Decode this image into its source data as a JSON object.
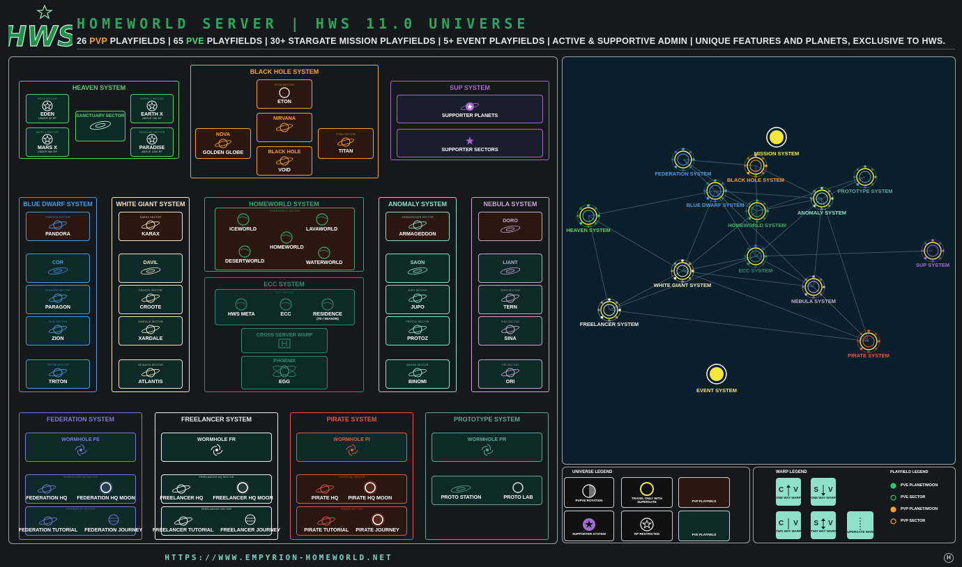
{
  "logo_text": "HWS",
  "title": "HOMEWORLD SERVER | HWS 11.0 UNIVERSE",
  "subtitle": {
    "a": "26 ",
    "b": "PVP",
    "c": " PLAYFIELDS | 65 ",
    "d": "PVE",
    "e": " PLAYFIELDS | 30+ STARGATE MISSION PLAYFIELDS | 5+ EVENT PLAYFIELDS | ACTIVE & SUPPORTIVE ADMIN | UNIQUE FEATURES AND PLANETS, EXCLUSIVE TO HWS."
  },
  "colors": {
    "pve": "#2bc46a",
    "pvp": "#f7a12c",
    "bg": "#15191c",
    "pvpbox": "#2b170f",
    "pvebox": "#0e2a28",
    "heaven": "#5bd06a",
    "blackhole": "#f5a332",
    "sup": "#a36bd0",
    "bluedwarf": "#4a9be0",
    "whitegiant": "#f2e6c4",
    "homeworld": "#3ba86e",
    "ecc": "#2e8a72",
    "anomaly": "#8ee0c8",
    "nebula": "#c9a6d2",
    "federation": "#7b7ad8",
    "freelancer": "#e8f0f0",
    "pirate": "#e55a42",
    "prototype": "#5da89a"
  },
  "systems": {
    "heaven": {
      "title": "HEAVEN SYSTEM",
      "eden": {
        "sec": "EDEN SECTOR",
        "name": "EDEN",
        "note": "UNDER 50 RP"
      },
      "earthx": {
        "sec": "EARTH X SECTOR",
        "name": "EARTH X",
        "note": "ABOVE 100 RP"
      },
      "sanctuary": "SANCTUARY SECTOR",
      "marsx": {
        "sec": "MARS X SECTOR",
        "name": "MARS X",
        "note": "UNDER 500 RP"
      },
      "paradise": {
        "sec": "PARADISE SECTOR",
        "name": "PARADISE",
        "note": "ABOVE 1000 RP"
      }
    },
    "blackhole": {
      "title": "BLACK HOLE SYSTEM",
      "eton": {
        "sec": "ETON SECTOR",
        "name": "ETON"
      },
      "nirvana": "NIRVANA",
      "nova": "NOVA",
      "golden": "GOLDEN GLOBE",
      "titan": {
        "sec": "TITAN SECTOR",
        "name": "TITAN"
      },
      "blackhole": "BLACK HOLE",
      "void": "VOID"
    },
    "sup": {
      "title": "SUP SYSTEM",
      "planets": "SUPPORTER PLANETS",
      "sectors": "SUPPORTER SECTORS"
    },
    "bluedwarf": {
      "title": "BLUE DWARF SYSTEM",
      "items": [
        {
          "sec": "PANDORA SECTOR",
          "name": "PANDORA"
        },
        {
          "sec": "",
          "name": "COR"
        },
        {
          "sec": "PARAGON SECTOR",
          "name": "PARAGON"
        },
        {
          "sec": "ZION SECTOR",
          "name": "ZION"
        },
        {
          "sec": "TRITON SECTOR",
          "name": "TRITON"
        }
      ]
    },
    "whitegiant": {
      "title": "WHITE GIANT SYSTEM",
      "items": [
        {
          "sec": "KARAX SECTOR",
          "name": "KARAX"
        },
        {
          "sec": "",
          "name": "DAVIL"
        },
        {
          "sec": "CROOTE SECTOR",
          "name": "CROOTE"
        },
        {
          "sec": "XARDALE SECTOR",
          "name": "XARDALE"
        },
        {
          "sec": "ATLANTIS SECTOR",
          "name": "ATLANTIS"
        }
      ]
    },
    "homeworld": {
      "title": "HOMEWORLD SYSTEM",
      "sec": "HOMEWORLD SECTOR",
      "iceworld": "ICEWORLD",
      "lavaworld": "LAVAWORLD",
      "homeworld": "HOMEWORLD",
      "desertworld": "DESERTWORLD",
      "waterworld": "WATERWORLD"
    },
    "ecc": {
      "title": "ECC SYSTEM",
      "sec": "ECC SECTOR",
      "hwsmeta": "HWS META",
      "ecc": "ECC",
      "residence": "RESIDENCE",
      "residence_note": "(7D / Season)",
      "warp": "CROSS SERVER WARP",
      "phoenix": "PHOENIX",
      "egg": "EGG"
    },
    "anomaly": {
      "title": "ANOMALY SYSTEM",
      "items": [
        {
          "sec": "ARMAGEDDON SECTOR",
          "name": "ARMAGEDDON"
        },
        {
          "sec": "",
          "name": "SAON"
        },
        {
          "sec": "JUPO SECTOR",
          "name": "JUPO"
        },
        {
          "sec": "PROTOZ SECTOR",
          "name": "PROTOZ"
        },
        {
          "sec": "BINOMI SECTOR",
          "name": "BINOMI"
        }
      ]
    },
    "nebula": {
      "title": "NEBULA SYSTEM",
      "items": [
        {
          "sec": "",
          "name": "DORO"
        },
        {
          "sec": "",
          "name": "LIANT"
        },
        {
          "sec": "TERN SECTOR",
          "name": "TERN"
        },
        {
          "sec": "SINA SECTOR",
          "name": "SINA"
        },
        {
          "sec": "ORI SECTOR",
          "name": "ORI"
        }
      ]
    },
    "federation": {
      "title": "FEDERATION SYSTEM",
      "wormhole": "WORMHOLE FE",
      "hqsec": "FEDERATION HQ SECTOR",
      "hq": "FEDERATION HQ",
      "moon": "FEDERATION HQ MOON",
      "tsec": "FEDERATION SECTOR",
      "tut": "FEDERATION TUTORIAL",
      "journey": "FEDERATION JOURNEY"
    },
    "freelancer": {
      "title": "FREELANCER SYSTEM",
      "wormhole": "WORMHOLE FR",
      "hqsec": "FREELANCER HQ SECTOR",
      "hq": "FREELANCER HQ",
      "moon": "FREELANCER HQ MOON",
      "tsec": "FREELANCER SECTOR",
      "tut": "FREELANCER TUTORIAL",
      "journey": "FREELANCER JOURNEY"
    },
    "pirate": {
      "title": "PIRATE SYSTEM",
      "wormhole": "WORMHOLE PI",
      "hqsec": "PIRATE HQ SECTOR",
      "hq": "PIRATE HQ",
      "moon": "PIRATE HQ MOON",
      "tsec": "PIRATE SECTOR",
      "tut": "PIRATE TUTORIAL",
      "journey": "PIRATE JOURNEY"
    },
    "prototype": {
      "title": "PROTOTYPE SYSTEM",
      "wormhole": "WORMHOLE PR",
      "station": "PROTO STATION",
      "lab": "PROTO LAB"
    }
  },
  "map_labels": {
    "mission": "MISSION SYSTEM",
    "federation": "FEDERATION SYSTEM",
    "blackhole": "BLACK HOLE SYSTEM",
    "prototype": "PROTOTYPE SYSTEM",
    "bluedwarf": "BLUE DWARF SYSTEM",
    "anomaly": "ANOMALY SYSTEM",
    "homeworld": "HOMEWORLD SYSTEM",
    "heaven": "HEAVEN SYSTEM",
    "ecc": "ECC SYSTEM",
    "sup": "SUP SYSTEM",
    "whitegiant": "WHITE GIANT SYSTEM",
    "nebula": "NEBULA SYSTEM",
    "freelancer": "FREELANCER SYSTEM",
    "pirate": "PIRATE SYSTEM",
    "event": "EVENT SYSTEM"
  },
  "universe_legend": {
    "title": "UNIVERSE LEGEND",
    "pvpve": "PvPvE ROTATION",
    "superwarp": "TRAVEL ONLY WITH SUPERGATE",
    "pvpfield": "PVP PLAYFIELD",
    "supporter": "SUPPORTER SYSTEM",
    "rp": "RP RESTRICTED",
    "pvefield": "PVE PLAYFIELD"
  },
  "warp_legend": {
    "title": "WARP LEGEND",
    "c": "C",
    "v": "V",
    "s": "S",
    "oneway1": "ONE WAY WARP",
    "oneway2": "ONE WAY WARP",
    "twoway1": "TWO WAY WARP",
    "twoway2": "TWO WAY WARP",
    "supergate": "SUPERGATE WARP"
  },
  "playfield_legend": {
    "title": "PLAYFIELD LEGEND",
    "items": [
      "PVE PLANET/MOON",
      "PVE SECTOR",
      "PVP PLANET/MOON",
      "PVP SECTOR"
    ]
  },
  "url": "HTTPS://WWW.EMPYRION-HOMEWORLD.NET",
  "badge": "H"
}
